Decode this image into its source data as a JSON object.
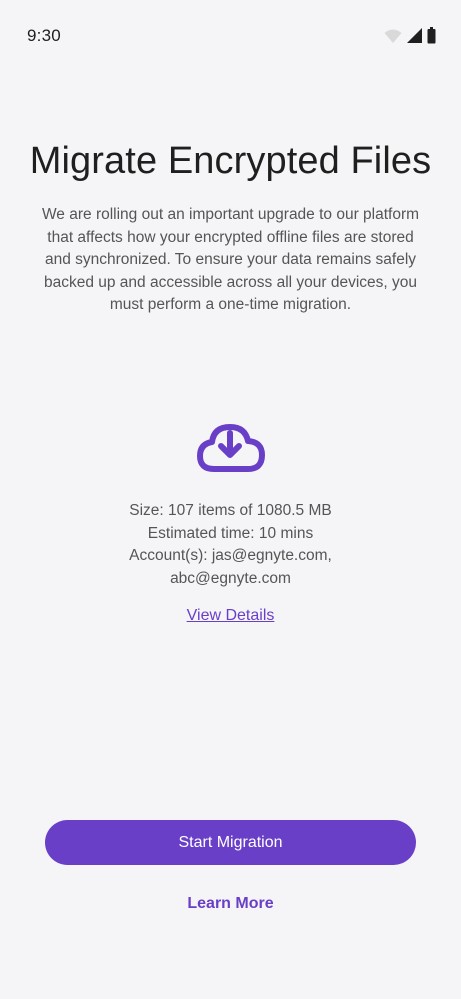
{
  "status_bar": {
    "time": "9:30",
    "icons": [
      "wifi-icon",
      "cellular-signal-icon",
      "battery-icon"
    ]
  },
  "title": "Migrate Encrypted Files",
  "description": "We are rolling out an important upgrade to our platform that affects how your encrypted offline files are stored and synchronized. To ensure your data remains safely backed up and accessible across all your devices, you must perform a one-time migration.",
  "icon": "cloud-download-icon",
  "info": {
    "size": "Size: 107 items of 1080.5 MB",
    "estimated_time": "Estimated time: 10 mins",
    "accounts_line1": "Account(s): jas@egnyte.com,",
    "accounts_line2": "abc@egnyte.com"
  },
  "view_details_label": "View Details",
  "start_button_label": "Start Migration",
  "learn_more_label": "Learn More",
  "colors": {
    "accent": "#6a3fc8",
    "background": "#f5f5f7",
    "text_primary": "#1f1f1f",
    "text_secondary": "#555555"
  }
}
